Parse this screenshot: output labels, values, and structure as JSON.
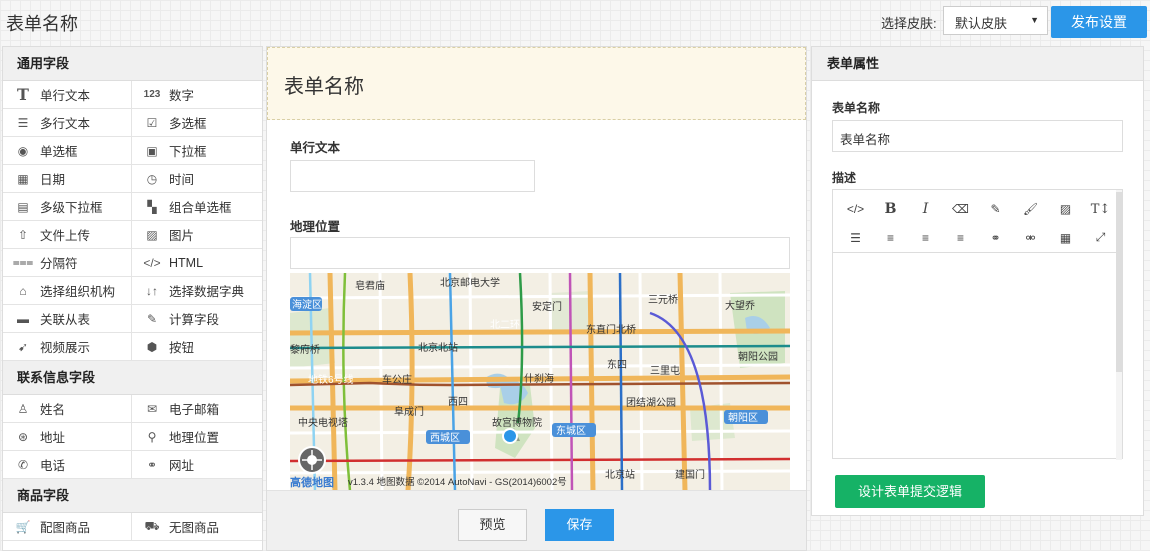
{
  "app": {
    "title": "表单名称"
  },
  "topbar": {
    "skin_label": "选择皮肤:",
    "skin_selected": "默认皮肤",
    "publish_label": "发布设置"
  },
  "palette": {
    "groups": [
      {
        "title": "通用字段",
        "items": [
          {
            "label": "单行文本",
            "icon": "text-T-icon"
          },
          {
            "label": "数字",
            "icon": "number-123-icon"
          },
          {
            "label": "多行文本",
            "icon": "multiline-text-icon"
          },
          {
            "label": "多选框",
            "icon": "checkbox-icon"
          },
          {
            "label": "单选框",
            "icon": "radio-icon"
          },
          {
            "label": "下拉框",
            "icon": "dropdown-icon"
          },
          {
            "label": "日期",
            "icon": "calendar-icon"
          },
          {
            "label": "时间",
            "icon": "clock-icon"
          },
          {
            "label": "多级下拉框",
            "icon": "multilevel-dropdown-icon"
          },
          {
            "label": "组合单选框",
            "icon": "combo-radio-icon"
          },
          {
            "label": "文件上传",
            "icon": "upload-icon"
          },
          {
            "label": "图片",
            "icon": "image-icon"
          },
          {
            "label": "分隔符",
            "icon": "divider-icon"
          },
          {
            "label": "HTML",
            "icon": "code-icon"
          },
          {
            "label": "选择组织机构",
            "icon": "organization-icon"
          },
          {
            "label": "选择数据字典",
            "icon": "sort-icon"
          },
          {
            "label": "关联从表",
            "icon": "table-link-icon"
          },
          {
            "label": "计算字段",
            "icon": "pencil-icon"
          },
          {
            "label": "视频展示",
            "icon": "video-icon"
          },
          {
            "label": "按钮",
            "icon": "button-icon"
          }
        ]
      },
      {
        "title": "联系信息字段",
        "items": [
          {
            "label": "姓名",
            "icon": "user-icon"
          },
          {
            "label": "电子邮箱",
            "icon": "envelope-icon"
          },
          {
            "label": "地址",
            "icon": "address-icon"
          },
          {
            "label": "地理位置",
            "icon": "location-pin-icon"
          },
          {
            "label": "电话",
            "icon": "phone-icon"
          },
          {
            "label": "网址",
            "icon": "link-icon"
          }
        ]
      },
      {
        "title": "商品字段",
        "items": [
          {
            "label": "配图商品",
            "icon": "cart-icon"
          },
          {
            "label": "无图商品",
            "icon": "cart-outline-icon"
          }
        ]
      }
    ]
  },
  "designer": {
    "form_title": "表单名称",
    "field1_label": "单行文本",
    "field2_label": "地理位置",
    "map_labels": {
      "bupt": "北京邮电大学",
      "haidian": "海淀区",
      "huangcun": "皂君庙",
      "andingmen": "安定门",
      "sanyuanqiao": "三元桥",
      "dawang": "大望乔",
      "dongzhimen": "东直门北桥",
      "erhuan": "北二环",
      "chaoyangpark": "朝阳公园",
      "ganjiakou": "黎府桥",
      "bjbei": "北京北站",
      "shichahai": "什刹海",
      "line6": "地铁6号线",
      "chegongzhuang": "车公庄",
      "dongsi": "东四",
      "sanlitun": "三里屯",
      "fuchengmen": "阜成门",
      "xisi": "西四",
      "xicheng": "西城区",
      "gugong": "故宫博物院",
      "dongcheng": "东城区",
      "tuanjiehu": "团结湖公园",
      "chaoyangqu": "朝阳区",
      "cctv": "中央电视塔",
      "bjstation": "北京站",
      "jianguomen": "建国门",
      "amap": "高德地图",
      "credit": "v1.3.4 地图数据 ©2014 AutoNavi - GS(2014)6002号"
    },
    "preview_label": "预览",
    "save_label": "保存"
  },
  "props": {
    "header": "表单属性",
    "name_label": "表单名称",
    "name_value": "表单名称",
    "desc_label": "描述",
    "toolbar": [
      "code-icon",
      "bold-icon",
      "italic-icon",
      "eraser-icon",
      "pen-icon",
      "brush-icon",
      "image-icon",
      "text-size-icon",
      "list-icon",
      "align-left-icon",
      "align-center-icon",
      "align-right-icon",
      "link-icon",
      "unlink-icon",
      "table-icon",
      "fullscreen-icon"
    ],
    "logic_button": "设计表单提交逻辑"
  },
  "colors": {
    "primary": "#2b96e8",
    "success": "#16b266",
    "banner": "#fdf8e9"
  }
}
